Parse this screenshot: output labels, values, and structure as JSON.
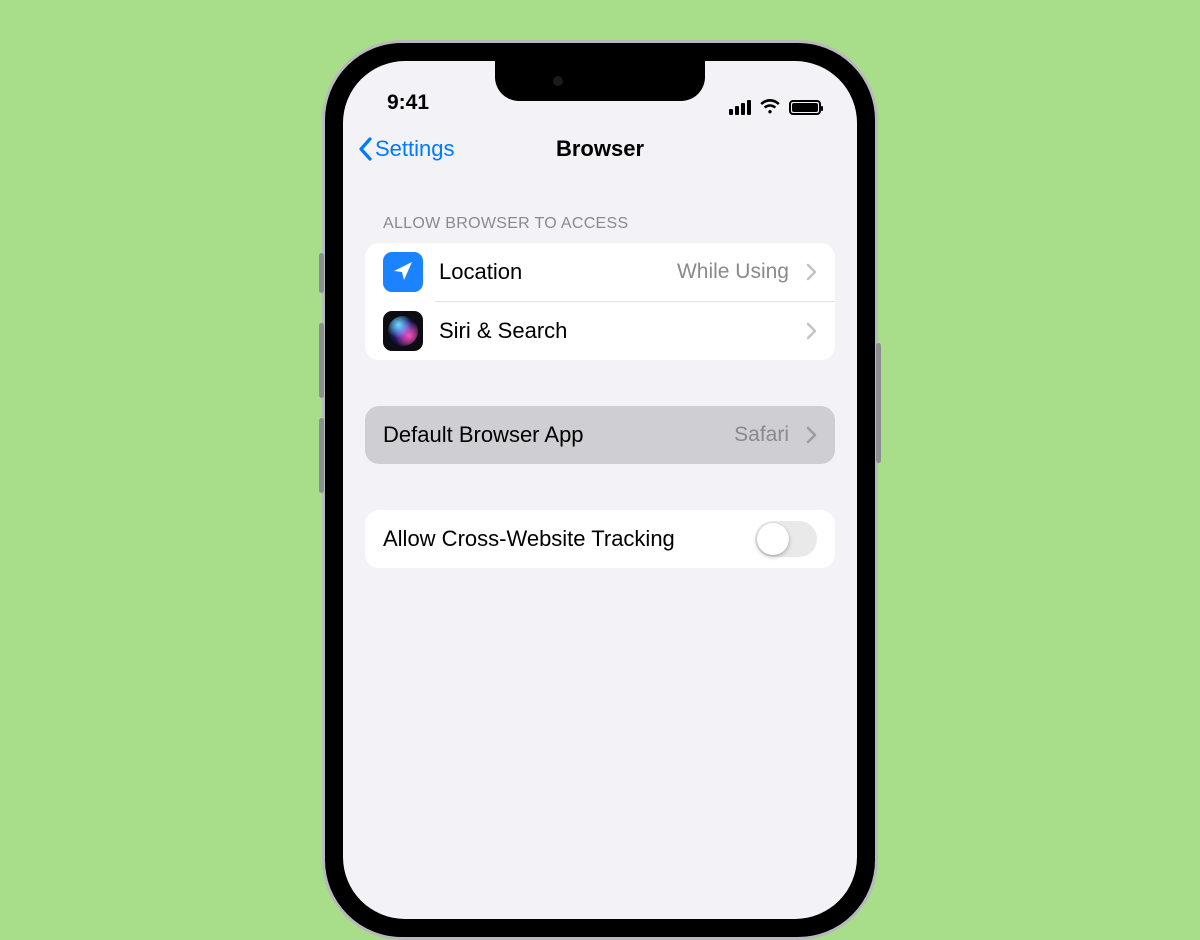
{
  "status": {
    "time": "9:41"
  },
  "nav": {
    "back_label": "Settings",
    "title": "Browser"
  },
  "section_access": {
    "header": "ALLOW BROWSER TO ACCESS",
    "rows": [
      {
        "label": "Location",
        "detail": "While Using"
      },
      {
        "label": "Siri & Search",
        "detail": ""
      }
    ]
  },
  "default_browser": {
    "label": "Default Browser App",
    "value": "Safari"
  },
  "tracking": {
    "label": "Allow Cross-Website Tracking",
    "enabled": false
  }
}
